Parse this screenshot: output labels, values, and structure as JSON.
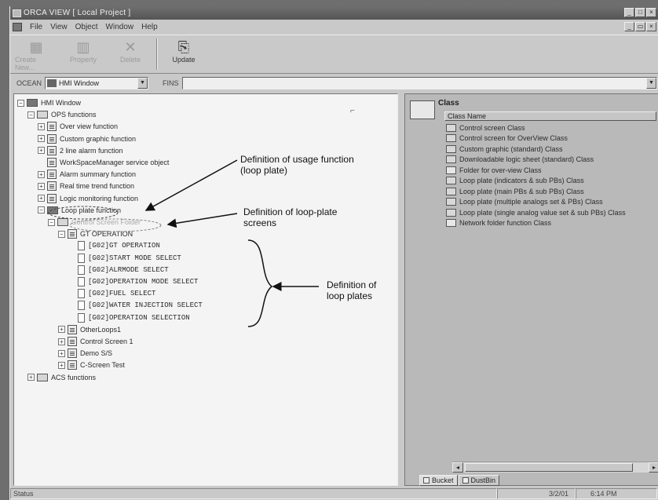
{
  "window": {
    "title": "ORCA VIEW [ Local Project ]",
    "minimize_glyph": "_",
    "maximize_glyph": "□",
    "close_glyph": "×",
    "restore_glyph": "▭"
  },
  "menu": [
    "File",
    "View",
    "Object",
    "Window",
    "Help"
  ],
  "toolbar": {
    "buttons": [
      {
        "label": "Create New...",
        "icon": "new-icon",
        "glyph": "▦",
        "enabled": false
      },
      {
        "label": "Property",
        "icon": "property-icon",
        "glyph": "▥",
        "enabled": false
      },
      {
        "label": "Delete",
        "icon": "delete-icon",
        "glyph": "✕",
        "enabled": false
      },
      {
        "label": "Update",
        "icon": "update-icon",
        "glyph": "⎘",
        "enabled": true
      }
    ]
  },
  "addressbar": {
    "ocean_label": "OCEAN",
    "ocean_value": "HMI Window",
    "fins_label": "FINS",
    "fins_value": "",
    "dropdown_glyph": "▼"
  },
  "tree": {
    "expand_glyph": "+",
    "collapse_glyph": "−",
    "nodes": [
      {
        "label": "HMI Window",
        "level": 0,
        "expander": "-",
        "icon": "folder-dark"
      },
      {
        "label": "OPS functions",
        "level": 1,
        "expander": "-",
        "icon": "folder"
      },
      {
        "label": "Over view function",
        "level": 2,
        "expander": "+",
        "icon": "sheet"
      },
      {
        "label": "Custom graphic function",
        "level": 2,
        "expander": "+",
        "icon": "sheet"
      },
      {
        "label": "2 line alarm function",
        "level": 2,
        "expander": "+",
        "icon": "sheet"
      },
      {
        "label": "WorkSpaceManager service object",
        "level": 2,
        "expander": "",
        "icon": "sheet"
      },
      {
        "label": "Alarm summary function",
        "level": 2,
        "expander": "+",
        "icon": "sheet"
      },
      {
        "label": "Real time trend function",
        "level": 2,
        "expander": "+",
        "icon": "sheet"
      },
      {
        "label": "Logic monitoring function",
        "level": 2,
        "expander": "+",
        "icon": "sheet"
      },
      {
        "label": "Loop plate function",
        "level": 2,
        "expander": "-",
        "icon": "folder-dark"
      },
      {
        "label": "Control Screen Folder",
        "level": 3,
        "expander": "-",
        "icon": "folder",
        "dim": true
      },
      {
        "label": "GT OPERATION",
        "level": 4,
        "expander": "-",
        "icon": "sheet"
      },
      {
        "label": "[G02]GT OPERATION",
        "level": 5,
        "expander": "",
        "icon": "loop",
        "mono": true
      },
      {
        "label": "[G02]START MODE SELECT",
        "level": 5,
        "expander": "",
        "icon": "loop",
        "mono": true
      },
      {
        "label": "[G02]ALRMODE SELECT",
        "level": 5,
        "expander": "",
        "icon": "loop",
        "mono": true
      },
      {
        "label": "[G02]OPERATION MODE SELECT",
        "level": 5,
        "expander": "",
        "icon": "loop",
        "mono": true
      },
      {
        "label": "[G02]FUEL SELECT",
        "level": 5,
        "expander": "",
        "icon": "loop",
        "mono": true
      },
      {
        "label": "[G02]WATER INJECTION SELECT",
        "level": 5,
        "expander": "",
        "icon": "loop",
        "mono": true
      },
      {
        "label": "[G02]OPERATION SELECTION",
        "level": 5,
        "expander": "",
        "icon": "loop",
        "mono": true
      },
      {
        "label": "OtherLoops1",
        "level": 4,
        "expander": "+",
        "icon": "sheet"
      },
      {
        "label": "Control Screen 1",
        "level": 4,
        "expander": "+",
        "icon": "sheet"
      },
      {
        "label": "Demo S/S",
        "level": 4,
        "expander": "+",
        "icon": "sheet"
      },
      {
        "label": "C-Screen Test",
        "level": 4,
        "expander": "+",
        "icon": "sheet"
      },
      {
        "label": "ACS functions",
        "level": 1,
        "expander": "+",
        "icon": "folder"
      }
    ]
  },
  "annotations": {
    "usage": [
      "Definition of usage function",
      "(loop  plate)"
    ],
    "screens": [
      "Definition of loop-plate",
      "screens"
    ],
    "plates": "Definition of loop plates"
  },
  "class_panel": {
    "title": "Class",
    "column_header": "Class Name",
    "items": [
      "Control screen Class",
      "Control screen for OverView Class",
      "Custom graphic (standard) Class",
      "Downloadable logic sheet (standard) Class",
      "Folder for over-view Class",
      "Loop plate (indicators & sub PBs) Class",
      "Loop plate (main PBs & sub PBs) Class",
      "Loop plate (multiple analogs set & PBs) Class",
      "Loop plate (single analog value set & sub PBs) Class",
      "Network folder function Class"
    ],
    "scroll_left_glyph": "◂",
    "scroll_right_glyph": "▸"
  },
  "tabs": [
    {
      "label": "Bucket",
      "active": true
    },
    {
      "label": "DustBin",
      "active": false
    }
  ],
  "statusbar": {
    "status": "Status",
    "date": "3/2/01",
    "time": "6:14 PM"
  },
  "misc": {
    "cursor_glyph": "⌐"
  }
}
